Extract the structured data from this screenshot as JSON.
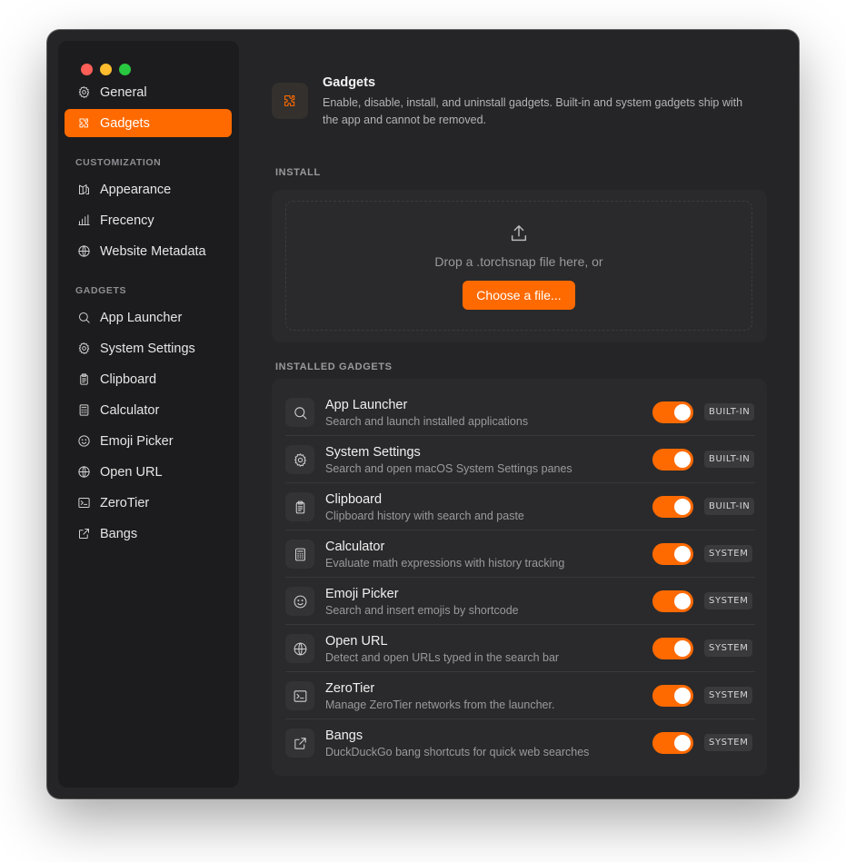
{
  "sidebar": {
    "top_items": [
      {
        "label": "General",
        "icon": "gear-icon"
      },
      {
        "label": "Gadgets",
        "icon": "puzzle-icon",
        "active": true
      }
    ],
    "sections": [
      {
        "title": "CUSTOMIZATION",
        "items": [
          {
            "label": "Appearance",
            "icon": "appearance-icon"
          },
          {
            "label": "Frecency",
            "icon": "bar-chart-icon"
          },
          {
            "label": "Website Metadata",
            "icon": "globe-icon"
          }
        ]
      },
      {
        "title": "GADGETS",
        "items": [
          {
            "label": "App Launcher",
            "icon": "search-icon"
          },
          {
            "label": "System Settings",
            "icon": "gear-icon"
          },
          {
            "label": "Clipboard",
            "icon": "clipboard-icon"
          },
          {
            "label": "Calculator",
            "icon": "calculator-icon"
          },
          {
            "label": "Emoji Picker",
            "icon": "smiley-icon"
          },
          {
            "label": "Open URL",
            "icon": "globe-icon"
          },
          {
            "label": "ZeroTier",
            "icon": "terminal-icon"
          },
          {
            "label": "Bangs",
            "icon": "external-link-icon"
          }
        ]
      }
    ]
  },
  "header": {
    "title": "Gadgets",
    "description": "Enable, disable, install, and uninstall gadgets. Built-in and system gadgets ship with the app and cannot be removed."
  },
  "install": {
    "label": "INSTALL",
    "drop_text": "Drop a .torchsnap file here, or",
    "button": "Choose a file..."
  },
  "installed": {
    "label": "INSTALLED GADGETS",
    "items": [
      {
        "name": "App Launcher",
        "desc": "Search and launch installed applications",
        "badge": "BUILT-IN",
        "enabled": true,
        "icon": "search-icon"
      },
      {
        "name": "System Settings",
        "desc": "Search and open macOS System Settings panes",
        "badge": "BUILT-IN",
        "enabled": true,
        "icon": "gear-icon"
      },
      {
        "name": "Clipboard",
        "desc": "Clipboard history with search and paste",
        "badge": "BUILT-IN",
        "enabled": true,
        "icon": "clipboard-icon"
      },
      {
        "name": "Calculator",
        "desc": "Evaluate math expressions with history tracking",
        "badge": "SYSTEM",
        "enabled": true,
        "icon": "calculator-icon"
      },
      {
        "name": "Emoji Picker",
        "desc": "Search and insert emojis by shortcode",
        "badge": "SYSTEM",
        "enabled": true,
        "icon": "smiley-icon"
      },
      {
        "name": "Open URL",
        "desc": "Detect and open URLs typed in the search bar",
        "badge": "SYSTEM",
        "enabled": true,
        "icon": "globe-icon"
      },
      {
        "name": "ZeroTier",
        "desc": "Manage ZeroTier networks from the launcher.",
        "badge": "SYSTEM",
        "enabled": true,
        "icon": "terminal-icon"
      },
      {
        "name": "Bangs",
        "desc": "DuckDuckGo bang shortcuts for quick web searches",
        "badge": "SYSTEM",
        "enabled": true,
        "icon": "external-link-icon"
      }
    ]
  },
  "colors": {
    "accent": "#ff6a00",
    "window_bg": "#252527",
    "sidebar_bg": "#1c1c1e"
  }
}
